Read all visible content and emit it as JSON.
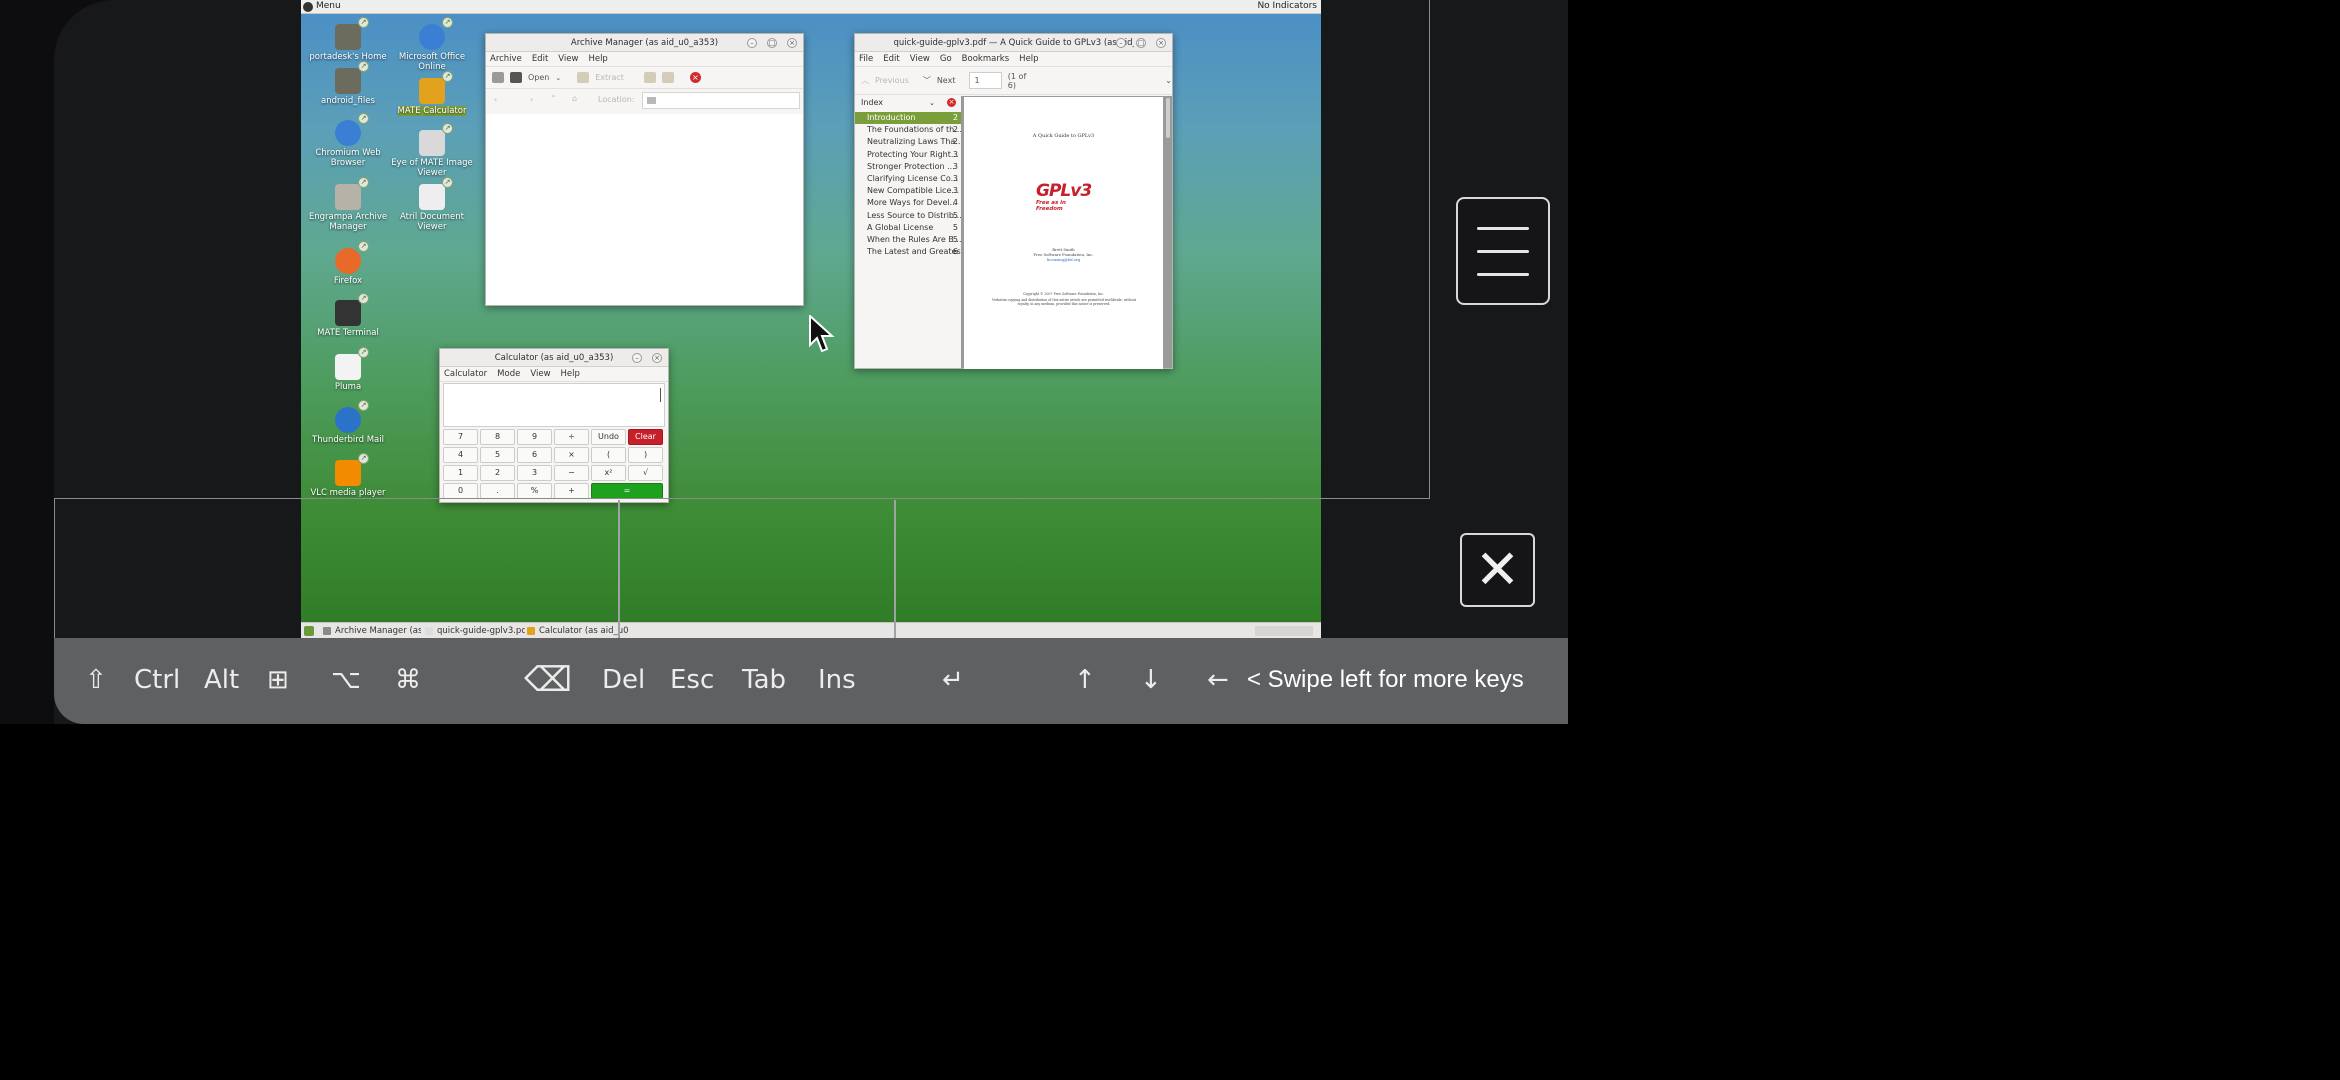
{
  "topbar": {
    "menu_label": "Menu",
    "indicators": "No Indicators"
  },
  "desktop_icons": [
    {
      "label": "portadesk's Home",
      "icon": "home-folder-icon",
      "color": "#6b6b5e"
    },
    {
      "label": "Microsoft Office Online",
      "icon": "chromium-icon",
      "color": "#3b7fd4"
    },
    {
      "label": "android_files",
      "icon": "folder-icon",
      "color": "#6b6b5e"
    },
    {
      "label": "MATE Calculator",
      "icon": "calculator-icon",
      "color": "#e2a21d"
    },
    {
      "label": "Chromium Web Browser",
      "icon": "chromium-icon",
      "color": "#3b7fd4"
    },
    {
      "label": "Eye of MATE Image Viewer",
      "icon": "image-viewer-icon",
      "color": "#d9d9d9"
    },
    {
      "label": "Engrampa Archive Manager",
      "icon": "archive-icon",
      "color": "#b7b2a8"
    },
    {
      "label": "Atril Document Viewer",
      "icon": "document-viewer-icon",
      "color": "#eeeeee"
    },
    {
      "label": "Firefox",
      "icon": "firefox-icon",
      "color": "#e86a2a"
    },
    {
      "label": "MATE Terminal",
      "icon": "terminal-icon",
      "color": "#333333"
    },
    {
      "label": "Pluma",
      "icon": "text-editor-icon",
      "color": "#f3f3f3"
    },
    {
      "label": "Thunderbird Mail",
      "icon": "thunderbird-icon",
      "color": "#2a73c9"
    },
    {
      "label": "VLC media player",
      "icon": "vlc-icon",
      "color": "#f28b00"
    }
  ],
  "archive_manager": {
    "title": "Archive Manager (as aid_u0_a353)",
    "menu": [
      "Archive",
      "Edit",
      "View",
      "Help"
    ],
    "toolbar": {
      "open": "Open",
      "extract": "Extract"
    },
    "location_label": "Location:"
  },
  "pdf_viewer": {
    "title": "quick-guide-gplv3.pdf — A Quick Guide to GPLv3 (as aid_u0",
    "menu": [
      "File",
      "Edit",
      "View",
      "Go",
      "Bookmarks",
      "Help"
    ],
    "previous": "Previous",
    "next": "Next",
    "page_input": "1",
    "page_count": "(1 of 6)",
    "sidebar_mode": "Index",
    "index": [
      {
        "title": "Introduction",
        "page": "2"
      },
      {
        "title": "The Foundations of th...",
        "page": "2"
      },
      {
        "title": "Neutralizing Laws Tha...",
        "page": "2"
      },
      {
        "title": "Protecting Your Right...",
        "page": "3"
      },
      {
        "title": "Stronger Protection ...",
        "page": "3"
      },
      {
        "title": "Clarifying License Co...",
        "page": "3"
      },
      {
        "title": "New Compatible Lice...",
        "page": "3"
      },
      {
        "title": "More Ways for Devel...",
        "page": "4"
      },
      {
        "title": "Less Source to Distrib...",
        "page": "5"
      },
      {
        "title": "A Global License",
        "page": "5"
      },
      {
        "title": "When the Rules Are B...",
        "page": "5"
      },
      {
        "title": "The Latest and Greatest",
        "page": "6"
      }
    ],
    "doc": {
      "heading": "A Quick Guide to GPLv3",
      "logo_main": "GPLv3",
      "logo_sub": "Free as in Freedom",
      "author": "Brett Smith",
      "org": "Free Software Foundation, Inc.",
      "email": "licensing@fsf.org",
      "copyright": "Copyright © 2007 Free Software Foundation, Inc.",
      "notice": "Verbatim copying and distribution of this entire article are permitted worldwide, without royalty, in any medium, provided this notice is preserved."
    }
  },
  "calculator": {
    "title": "Calculator (as aid_u0_a353)",
    "menu": [
      "Calculator",
      "Mode",
      "View",
      "Help"
    ],
    "rows": [
      [
        "7",
        "8",
        "9",
        "÷",
        "Undo",
        "Clear"
      ],
      [
        "4",
        "5",
        "6",
        "×",
        "(",
        ")"
      ],
      [
        "1",
        "2",
        "3",
        "−",
        "x²",
        "√"
      ],
      [
        "0",
        ".",
        "%",
        "+",
        "="
      ]
    ]
  },
  "taskbar": [
    "Archive Manager (as ...",
    "quick-guide-gplv3.pdf...",
    "Calculator (as aid_u0..."
  ],
  "keys": [
    "⇧",
    "Ctrl",
    "Alt",
    "⊞",
    "⌥",
    "⌘",
    "⌫",
    "Del",
    "Esc",
    "Tab",
    "Ins",
    "↵",
    "↑",
    "↓",
    "←"
  ],
  "swipe_hint": "< Swipe left for more keys",
  "colors": {
    "accent": "#7a9e3a",
    "clear": "#c8202b",
    "equals": "#1ea21e"
  }
}
